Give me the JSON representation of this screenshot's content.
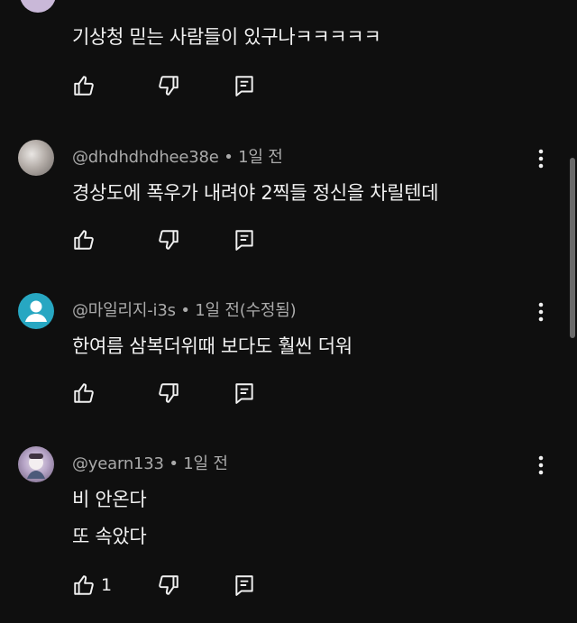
{
  "comments": [
    {
      "author": "",
      "time": "",
      "text": "기상청 믿는 사람들이 있구나ㅋㅋㅋㅋㅋ",
      "likes": ""
    },
    {
      "author": "@dhdhdhdhee38e",
      "time": "• 1일 전",
      "text": "경상도에 폭우가 내려야 2찍들 정신을 차릴텐데",
      "likes": ""
    },
    {
      "author": "@마일리지-i3s",
      "time": "• 1일 전(수정됨)",
      "text": "한여름 삼복더위때 보다도 훨씬 더워",
      "likes": ""
    },
    {
      "author": "@yearn133",
      "time": "• 1일 전",
      "text_lines": [
        "비 안온다",
        "또 속았다"
      ],
      "likes": "1"
    }
  ],
  "icons": {
    "like": "thumbs-up-icon",
    "dislike": "thumbs-down-icon",
    "reply": "reply-icon",
    "more": "more-vertical-icon"
  },
  "colors": {
    "background": "#0f0f0f",
    "text": "#f1f1f1",
    "secondary_text": "#aaaaaa",
    "avatar_teal": "#27a7c2"
  }
}
